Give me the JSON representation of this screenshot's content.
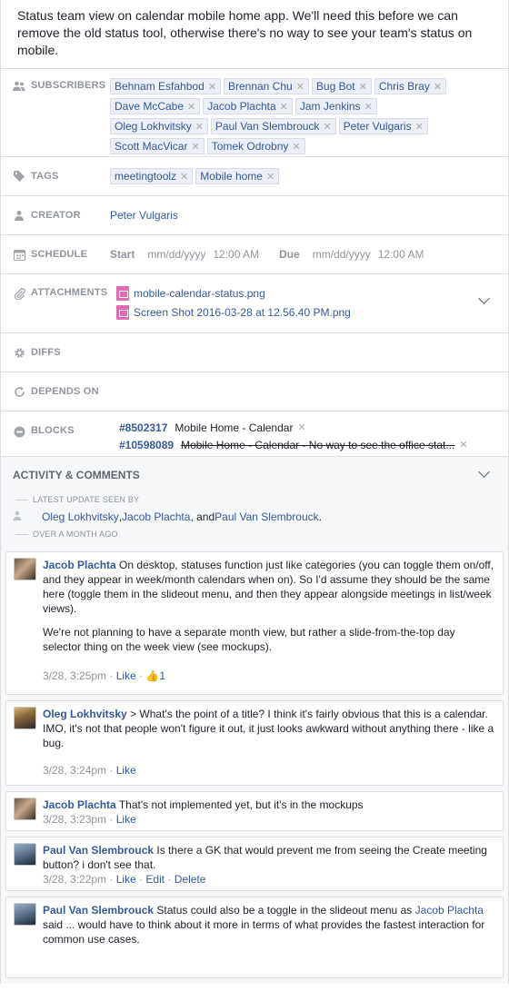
{
  "description": "Status team view on calendar mobile home app. We'll need this before we can remove the old status tool, otherwise there's no way to see your team's status on mobile.",
  "fields": {
    "subscribers_label": "SUBSCRIBERS",
    "subscribers": [
      "Behnam Esfahbod",
      "Brennan Chu",
      "Bug Bot",
      "Chris Bray",
      "Dave McCabe",
      "Jacob Plachta",
      "Jam Jenkins",
      "Oleg Lokhvitsky",
      "Paul Van Slembrouck",
      "Peter Vulgaris",
      "Scott MacVicar",
      "Tomek Odrobny"
    ],
    "tags_label": "TAGS",
    "tags": [
      "meetingtoolz",
      "Mobile home"
    ],
    "creator_label": "CREATOR",
    "creator": "Peter Vulgaris",
    "schedule_label": "SCHEDULE",
    "schedule": {
      "start_label": "Start",
      "start_date_placeholder": "mm/dd/yyyy",
      "start_time": "12:00 AM",
      "due_label": "Due",
      "due_date_placeholder": "mm/dd/yyyy",
      "due_time": "12:00 AM"
    },
    "attachments_label": "ATTACHMENTS",
    "attachments": [
      "mobile-calendar-status.png",
      "Screen Shot 2016-03-28 at 12.56.40 PM.png"
    ],
    "diffs_label": "DIFFS",
    "depends_label": "DEPENDS ON",
    "blocks_label": "BLOCKS",
    "blocks": [
      {
        "id": "#8502317",
        "title": "Mobile Home - Calendar",
        "closed": false
      },
      {
        "id": "#10598089",
        "title": "Mobile Home - Calendar - No way to see the office stat...",
        "closed": true
      }
    ]
  },
  "activity": {
    "title": "ACTIVITY & COMMENTS",
    "latest_label": "LATEST UPDATE SEEN BY",
    "seen_by": [
      "Oleg Lokhvitsky",
      "Jacob Plachta",
      "Paul Van Slembrouck"
    ],
    "seen_sep1": ", ",
    "seen_sep2": ", and ",
    "seen_end": ".",
    "over_label": "OVER A MONTH AGO",
    "like_label": "Like",
    "edit_label": "Edit",
    "delete_label": "Delete",
    "comments": [
      {
        "author": "Jacob Plachta",
        "text": "On desktop, statuses function just like categories (you can toggle them on/off, and they appear in week/month calendars when on). So I'd assume they should be the same here (toggle them in the slideout menu, and then they appear alongside meetings in list/week views).",
        "text2": "We're not planning to have a separate month view, but rather a slide-from-the-top day selector thing on the week view (see mockups).",
        "time": "3/28, 3:25pm",
        "likes": "1"
      },
      {
        "author": "Oleg Lokhvitsky",
        "text": "> What's the point of a title? I think it's fairly obvious that this is a calendar. IMO, it's not that people won't figure it out, it just looks awkward without anything there - like a bug.",
        "time": "3/28, 3:24pm"
      },
      {
        "author": "Jacob Plachta",
        "text": "That's not implemented yet, but it's in the mockups",
        "time": "3/28, 3:23pm"
      },
      {
        "author": "Paul Van Slembrouck",
        "text": "Is there a GK that would prevent me from seeing the Create meeting button?  i don't see that.",
        "time": "3/28, 3:22pm"
      },
      {
        "author": "Paul Van Slembrouck",
        "text_a": "Status could also be a toggle in the slideout menu as",
        "mention": "Jacob Plachta",
        "text_b": "said  ... would have to think about it more in terms of what provides the fastest interaction for common use cases."
      }
    ]
  }
}
